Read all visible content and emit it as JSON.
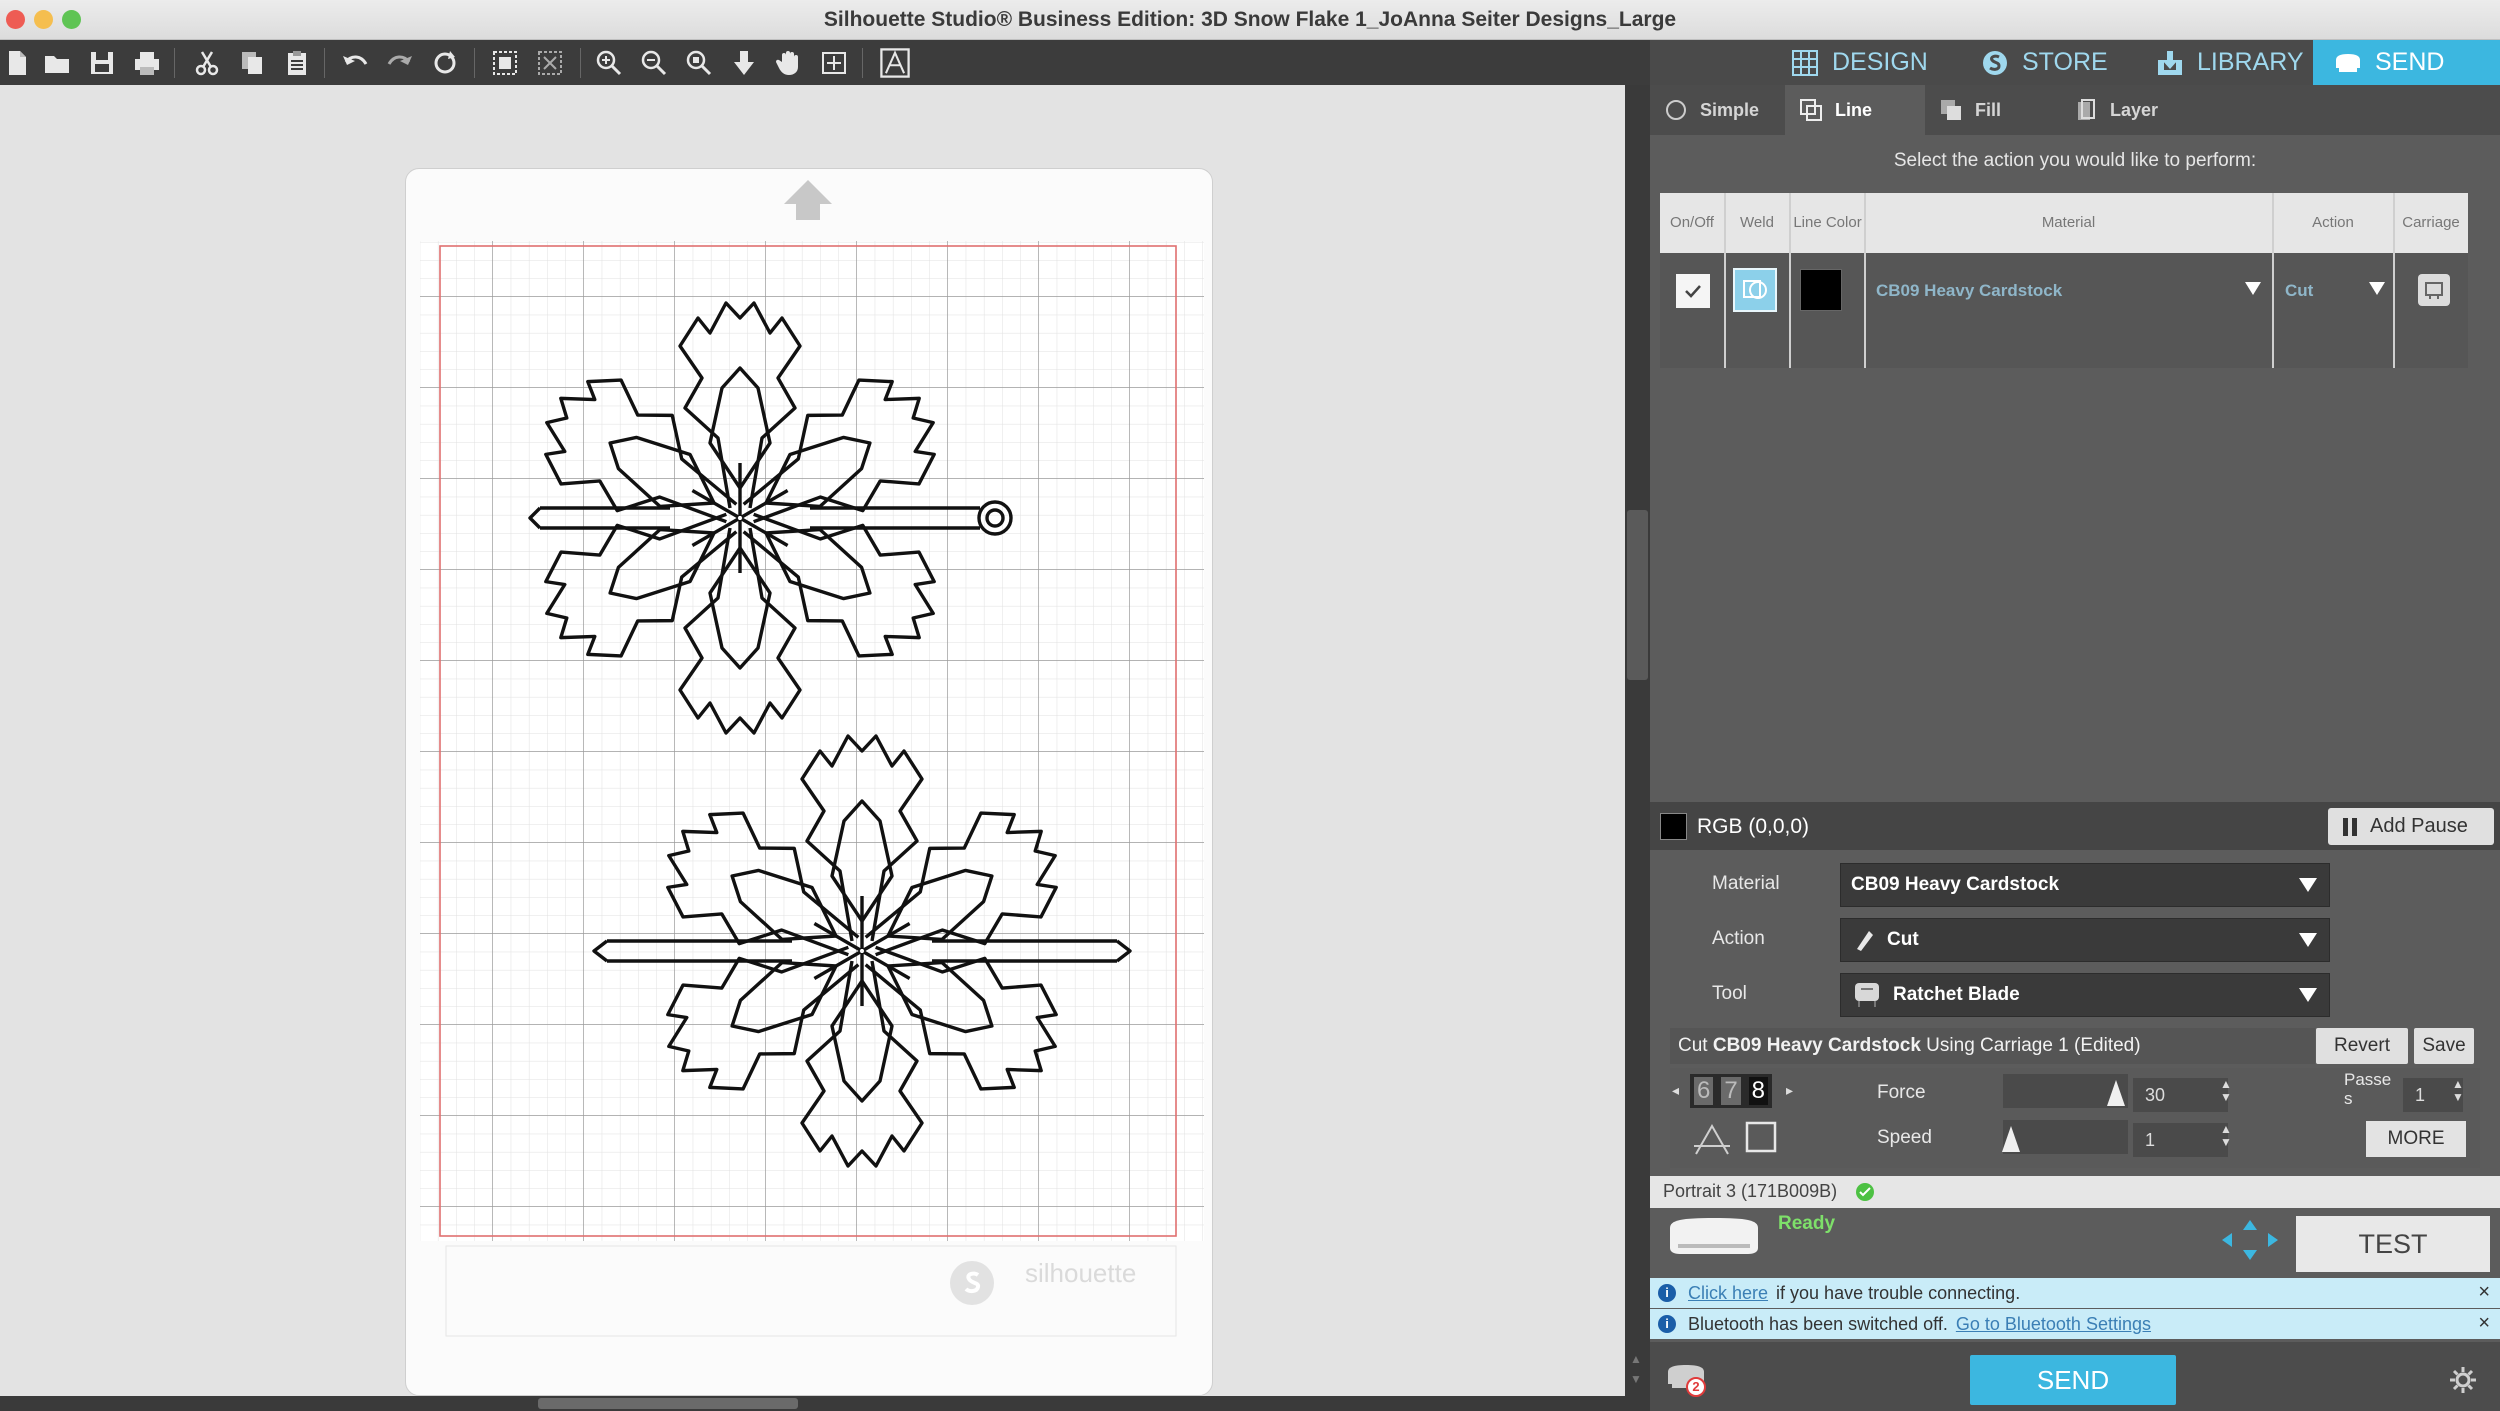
{
  "window": {
    "title": "Silhouette Studio® Business Edition: 3D Snow Flake 1_JoAnna Seiter Designs_Large"
  },
  "colors": {
    "accent": "#3cb7e0",
    "nav_text": "#9fd8ee",
    "red_margin": "#e07070"
  },
  "toolbar": {
    "icons": [
      "new-file-icon",
      "open-folder-icon",
      "save-icon",
      "print-icon",
      "cut-icon",
      "copy-icon",
      "paste-icon",
      "undo-icon",
      "redo-icon",
      "redraw-icon",
      "select-all-icon",
      "deselect-icon",
      "zoom-in-icon",
      "zoom-out-icon",
      "zoom-fit-icon",
      "move-down-icon",
      "pan-hand-icon",
      "fit-page-icon",
      "trace-icon"
    ]
  },
  "nav": {
    "design": "DESIGN",
    "store": "STORE",
    "library": "LIBRARY",
    "send": "SEND"
  },
  "send_tabs": {
    "simple": "Simple",
    "line": "Line",
    "fill": "Fill",
    "layer": "Layer"
  },
  "instruction": "Select the action you would like to perform:",
  "table": {
    "headers": [
      "On/Off",
      "Weld",
      "Line Color",
      "Material",
      "Action",
      "Carriage"
    ],
    "row": {
      "material": "CB09 Heavy Cardstock",
      "action": "Cut",
      "line_color": "#000000"
    }
  },
  "color_bar": {
    "label": "RGB (0,0,0)",
    "add_pause": "Add Pause"
  },
  "properties": {
    "material_label": "Material",
    "material_value": "CB09 Heavy Cardstock",
    "action_label": "Action",
    "action_value": "Cut",
    "tool_label": "Tool",
    "tool_value": "Ratchet Blade"
  },
  "cut_settings": {
    "header_prefix": "Cut ",
    "header_material": "CB09 Heavy Cardstock",
    "header_suffix": " Using Carriage 1 (Edited)",
    "revert": "Revert",
    "save": "Save",
    "blade_digits": [
      "6",
      "7",
      "8"
    ],
    "force_label": "Force",
    "force_value": "30",
    "speed_label": "Speed",
    "speed_value": "1",
    "passes_label": "Passe s",
    "passes_value": "1",
    "more": "MORE"
  },
  "device": {
    "name": "Portrait 3 (171B009B)",
    "status": "Ready",
    "test": "TEST"
  },
  "info": {
    "line1_link": "Click here",
    "line1_text": "if you have trouble connecting.",
    "line2_text": "Bluetooth has been switched off.",
    "line2_link": "Go to Bluetooth Settings"
  },
  "bottom": {
    "send": "SEND",
    "badge": "2"
  },
  "mat_brand": "silhouette"
}
